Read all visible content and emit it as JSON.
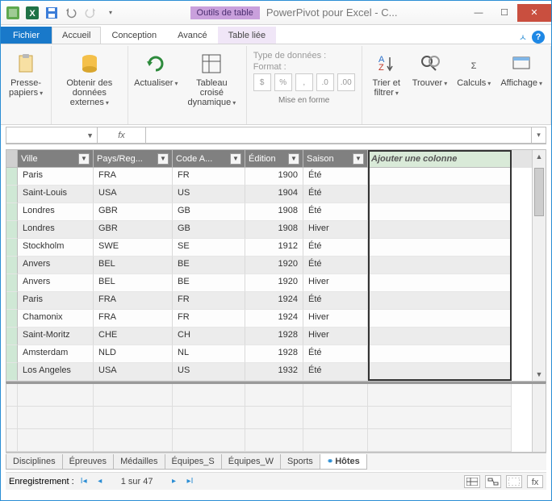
{
  "titlebar": {
    "tool_tab": "Outils de table",
    "app_title": "PowerPivot pour Excel - C..."
  },
  "ribbon_tabs": {
    "file": "Fichier",
    "home": "Accueil",
    "design": "Conception",
    "advanced": "Avancé",
    "linked": "Table liée"
  },
  "ribbon": {
    "clipboard": {
      "paste": "Presse-\npapiers"
    },
    "external": {
      "get": "Obtenir des\ndonnées externes"
    },
    "refresh": "Actualiser",
    "pivot": "Tableau croisé\ndynamique",
    "format_group": {
      "datatype": "Type de données :",
      "format": "Format :",
      "label": "Mise en forme"
    },
    "sort_filter": "Trier et\nfiltrer",
    "find": "Trouver",
    "calc": "Calculs",
    "view": "Affichage"
  },
  "formula": {
    "fx": "fx"
  },
  "columns": {
    "ville": "Ville",
    "pays": "Pays/Reg...",
    "code": "Code A...",
    "edition": "Édition",
    "saison": "Saison",
    "add": "Ajouter une colonne"
  },
  "rows": [
    {
      "ville": "Paris",
      "pays": "FRA",
      "code": "FR",
      "edition": 1900,
      "saison": "Été"
    },
    {
      "ville": "Saint-Louis",
      "pays": "USA",
      "code": "US",
      "edition": 1904,
      "saison": "Été"
    },
    {
      "ville": "Londres",
      "pays": "GBR",
      "code": "GB",
      "edition": 1908,
      "saison": "Été"
    },
    {
      "ville": "Londres",
      "pays": "GBR",
      "code": "GB",
      "edition": 1908,
      "saison": "Hiver"
    },
    {
      "ville": "Stockholm",
      "pays": "SWE",
      "code": "SE",
      "edition": 1912,
      "saison": "Été"
    },
    {
      "ville": "Anvers",
      "pays": "BEL",
      "code": "BE",
      "edition": 1920,
      "saison": "Été"
    },
    {
      "ville": "Anvers",
      "pays": "BEL",
      "code": "BE",
      "edition": 1920,
      "saison": "Hiver"
    },
    {
      "ville": "Paris",
      "pays": "FRA",
      "code": "FR",
      "edition": 1924,
      "saison": "Été"
    },
    {
      "ville": "Chamonix",
      "pays": "FRA",
      "code": "FR",
      "edition": 1924,
      "saison": "Hiver"
    },
    {
      "ville": "Saint-Moritz",
      "pays": "CHE",
      "code": "CH",
      "edition": 1928,
      "saison": "Hiver"
    },
    {
      "ville": "Amsterdam",
      "pays": "NLD",
      "code": "NL",
      "edition": 1928,
      "saison": "Été"
    },
    {
      "ville": "Los Angeles",
      "pays": "USA",
      "code": "US",
      "edition": 1932,
      "saison": "Été"
    }
  ],
  "sheet_tabs": [
    "Disciplines",
    "Épreuves",
    "Médailles",
    "Équipes_S",
    "Équipes_W",
    "Sports",
    "Hôtes"
  ],
  "status": {
    "label": "Enregistrement :",
    "pos": "1 sur 47"
  }
}
